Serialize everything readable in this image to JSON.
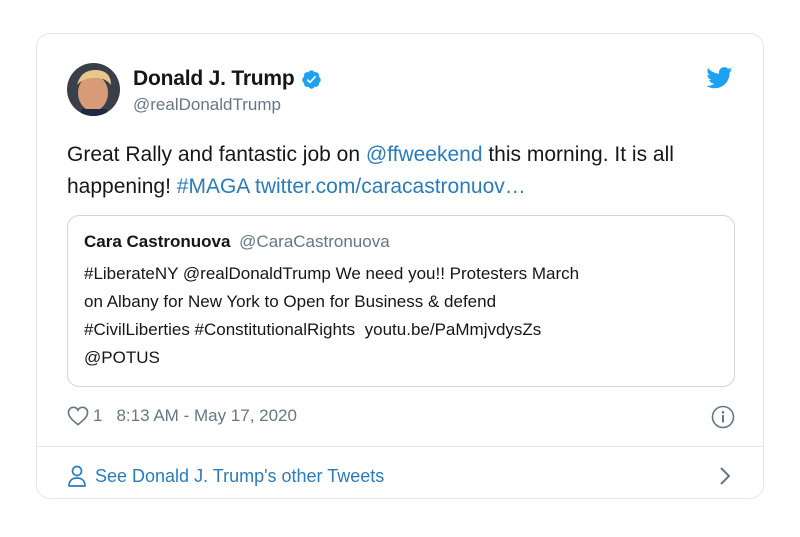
{
  "author": {
    "display_name": "Donald J. Trump",
    "handle": "@realDonaldTrump",
    "verified": true
  },
  "tweet": {
    "text_parts": [
      {
        "text": "Great Rally and fantastic job on ",
        "type": "plain"
      },
      {
        "text": "@ffweekend",
        "type": "link"
      },
      {
        "text": " this morning. It is all happening! ",
        "type": "plain"
      },
      {
        "text": "#MAGA",
        "type": "link"
      },
      {
        "text": " ",
        "type": "plain"
      },
      {
        "text": "twitter.com/caracastronuov…",
        "type": "link"
      }
    ]
  },
  "quoted_tweet": {
    "display_name": "Cara Castronuova",
    "handle": "@CaraCastronuova",
    "text": "#LiberateNY @realDonaldTrump We need you!! Protesters March\non Albany for New York to Open for Business & defend\n#CivilLiberties #ConstitutionalRights  youtu.be/PaMmjvdysZs\n@POTUS"
  },
  "meta": {
    "like_count": "1",
    "timestamp": "8:13 AM - May 17, 2020"
  },
  "footer": {
    "link_label": "See Donald J. Trump's other Tweets"
  },
  "icons": {
    "verified": "verified-badge-icon",
    "brand": "twitter-bird-icon",
    "like": "heart-icon",
    "info": "info-icon",
    "profile": "person-icon",
    "chevron": "chevron-right-icon"
  },
  "colors": {
    "link": "#2b7bb9",
    "brand": "#1da1f2",
    "muted": "#657786",
    "border": "#e1e8ed"
  }
}
